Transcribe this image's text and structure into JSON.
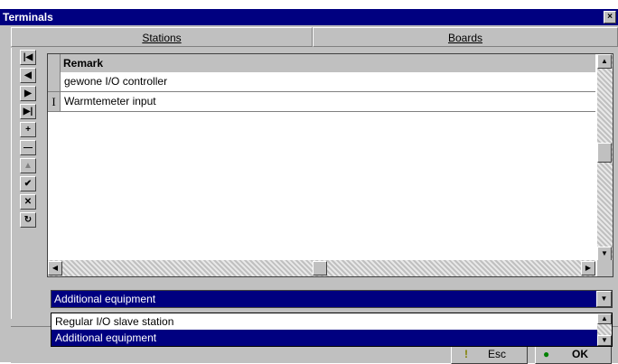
{
  "window": {
    "title": "Terminals",
    "close_glyph": "×"
  },
  "tabs": [
    {
      "label": "Stations",
      "active": true
    },
    {
      "label": "Boards",
      "active": false
    }
  ],
  "navigator": {
    "buttons": [
      {
        "icon": "first-record-icon",
        "glyph": "|◀"
      },
      {
        "icon": "prior-record-icon",
        "glyph": "◀"
      },
      {
        "icon": "next-record-icon",
        "glyph": "▶"
      },
      {
        "icon": "last-record-icon",
        "glyph": "▶|"
      },
      {
        "icon": "insert-record-icon",
        "glyph": "+"
      },
      {
        "icon": "delete-record-icon",
        "glyph": "—"
      },
      {
        "icon": "edit-record-icon",
        "glyph": "▲"
      },
      {
        "icon": "post-record-icon",
        "glyph": "✔"
      },
      {
        "icon": "cancel-record-icon",
        "glyph": "✕"
      },
      {
        "icon": "refresh-record-icon",
        "glyph": "↻"
      }
    ]
  },
  "grid": {
    "column_header": "Remark",
    "rows": [
      {
        "remark": "gewone I/O controller",
        "indicator": ""
      },
      {
        "remark": "Warmtemeter input",
        "indicator": "I"
      }
    ]
  },
  "combo": {
    "value": "Additional equipment",
    "options": [
      "Regular I/O slave station",
      "Additional equipment"
    ],
    "selected_index": 1
  },
  "buttons": {
    "cancel_label": "Esc",
    "ok_label": "OK"
  },
  "colors": {
    "titlebar": "#000080",
    "selection": "#000080",
    "face": "#c0c0c0"
  }
}
